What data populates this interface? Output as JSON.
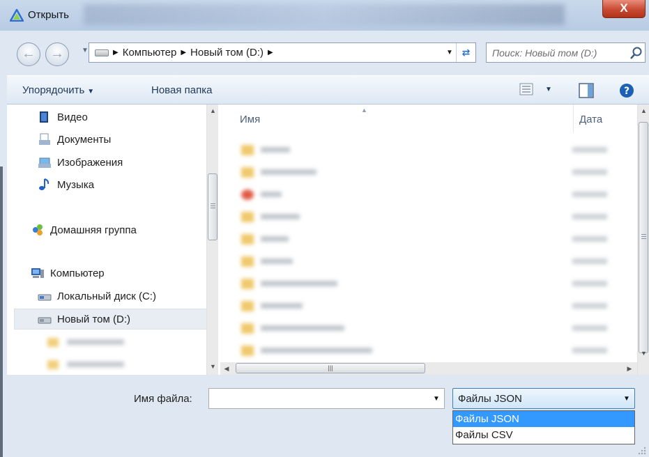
{
  "window": {
    "title": "Открыть",
    "close_label": "X"
  },
  "address": {
    "crumbs": [
      "Компьютер",
      "Новый том (D:)"
    ],
    "search_placeholder": "Поиск: Новый том (D:)"
  },
  "toolbar": {
    "organize_label": "Упорядочить",
    "new_folder_label": "Новая папка"
  },
  "tree": {
    "libraries": [
      {
        "label": "Видео",
        "icon": "video-library-icon"
      },
      {
        "label": "Документы",
        "icon": "documents-library-icon"
      },
      {
        "label": "Изображения",
        "icon": "pictures-library-icon"
      },
      {
        "label": "Музыка",
        "icon": "music-library-icon"
      }
    ],
    "homegroup": "Домашняя группа",
    "computer": "Компьютер",
    "drives": [
      {
        "label": "Локальный диск (C:)",
        "selected": false
      },
      {
        "label": "Новый том (D:)",
        "selected": true
      }
    ]
  },
  "file_list": {
    "columns": {
      "name": "Имя",
      "date": "Дата"
    }
  },
  "bottom": {
    "filename_label": "Имя файла:",
    "filename_value": "",
    "filetype_selected": "Файлы JSON",
    "filetype_options": [
      "Файлы JSON",
      "Файлы CSV"
    ]
  },
  "colors": {
    "selection": "#3399ff",
    "toolbar_text": "#1e395b",
    "close_button": "#c74a32"
  }
}
